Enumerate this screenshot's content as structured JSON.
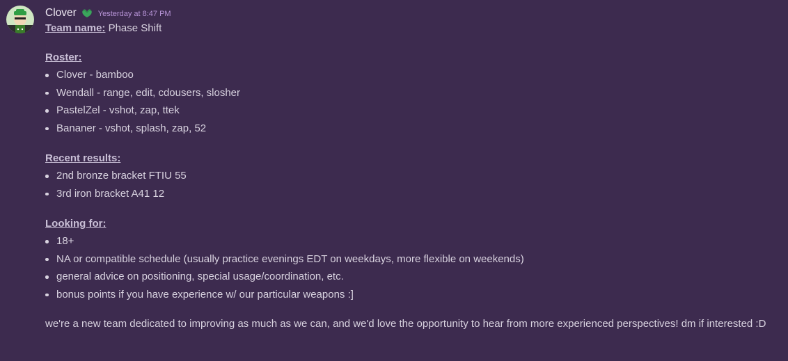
{
  "message": {
    "author": "Clover",
    "role_icon": "green-leaf-badge-icon",
    "timestamp": "Yesterday at 8:47 PM",
    "team_name_label": "Team name:",
    "team_name_value": " Phase Shift",
    "roster": {
      "label": "Roster:",
      "items": [
        "Clover - bamboo",
        "Wendall - range, edit, cdousers, slosher",
        "PastelZel - vshot, zap, ttek",
        "Bananer - vshot, splash, zap, 52"
      ]
    },
    "recent_results": {
      "label": "Recent results:",
      "items": [
        "2nd bronze bracket FTIU 55",
        "3rd iron bracket A41 12"
      ]
    },
    "looking_for": {
      "label": "Looking for:",
      "items": [
        "18+",
        "NA or compatible schedule (usually practice evenings EDT on weekdays, more flexible on weekends)",
        "general advice on positioning, special usage/coordination, etc.",
        "bonus points if you have experience w/ our particular weapons :]"
      ]
    },
    "closing": "we're a new team dedicated to improving as much as we can, and we'd love the opportunity to hear from more experienced perspectives! dm if interested :D"
  },
  "colors": {
    "background": "#3d2b4f",
    "text": "#d8d2df",
    "timestamp": "#b995d9",
    "role_icon": "#3ba55c"
  }
}
